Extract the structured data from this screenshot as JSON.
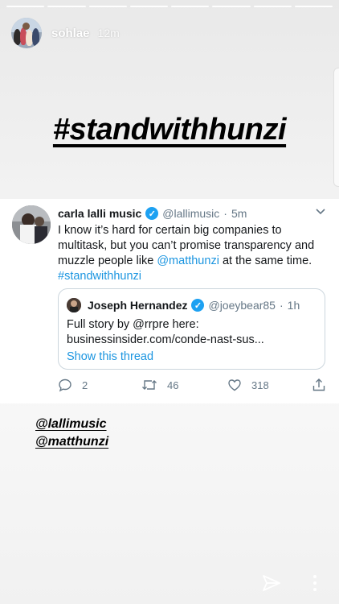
{
  "story": {
    "username": "sohlae",
    "time": "12m",
    "segments": 8
  },
  "hashtag": "#standwithhunzi",
  "tweet": {
    "display_name": "carla lalli music",
    "handle": "@lallimusic",
    "time": "5m",
    "text_before": "I know it’s hard for certain big companies to multitask, but you can’t promise transparency and muzzle people like ",
    "mention": "@matthunzi",
    "text_after": " at the same time.",
    "hashtag": "#standwithhunzi",
    "quote": {
      "display_name": "Joseph Hernandez",
      "handle": "@joeybear85",
      "time": "1h",
      "text": "Full story by @rrpre here: businessinsider.com/conde-nast-sus...",
      "thread_link": "Show this thread"
    },
    "replies": "2",
    "retweets": "46",
    "likes": "318"
  },
  "mentions": [
    "@lallimusic",
    "@matthunzi"
  ],
  "colors": {
    "link": "#1b95e0",
    "verified": "#1da1f2",
    "muted": "#657786"
  }
}
